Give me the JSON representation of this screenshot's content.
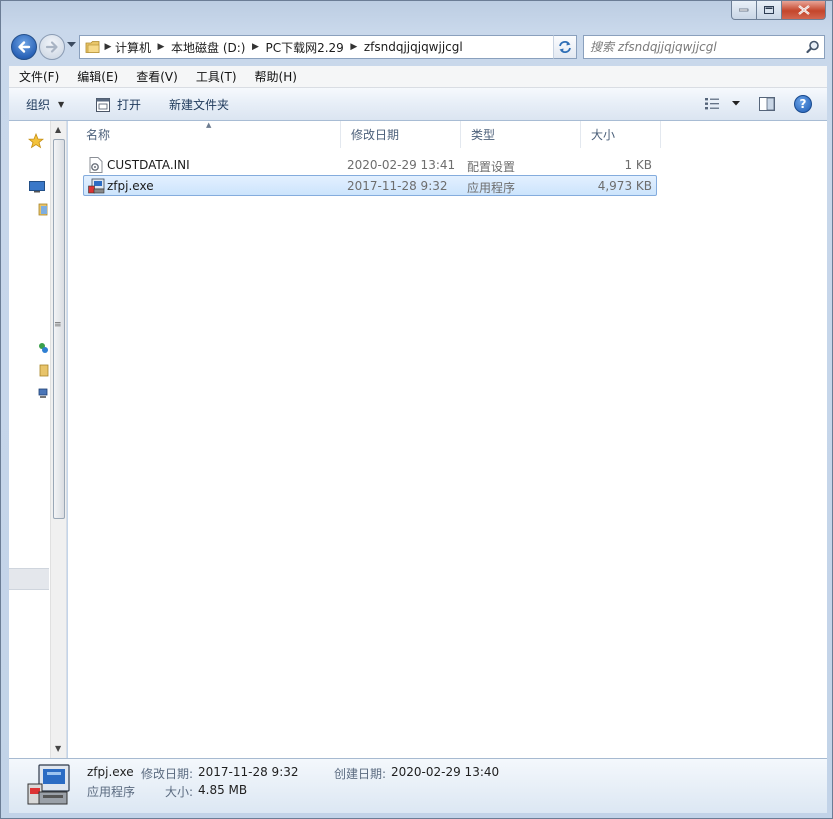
{
  "window": {
    "caption_buttons": [
      "minimize",
      "maximize",
      "close"
    ]
  },
  "address": {
    "breadcrumbs": [
      "计算机",
      "本地磁盘 (D:)",
      "PC下载网2.29",
      "zfsndqjjqjqwjjcgl"
    ]
  },
  "search": {
    "placeholder": "搜索 zfsndqjjqjqwjjcgl"
  },
  "menu": {
    "items": [
      "文件(F)",
      "编辑(E)",
      "查看(V)",
      "工具(T)",
      "帮助(H)"
    ]
  },
  "toolbar": {
    "organize_label": "组织",
    "open_label": "打开",
    "new_folder_label": "新建文件夹"
  },
  "columns": {
    "name": "名称",
    "date": "修改日期",
    "type": "类型",
    "size": "大小"
  },
  "files": [
    {
      "name": "CUSTDATA.INI",
      "date": "2020-02-29 13:41",
      "type": "配置设置",
      "size": "1 KB",
      "icon": "ini-settings-file-icon",
      "selected": false
    },
    {
      "name": "zfpj.exe",
      "date": "2017-11-28 9:32",
      "type": "应用程序",
      "size": "4,973 KB",
      "icon": "setup-installer-icon",
      "selected": true
    }
  ],
  "details": {
    "filename": "zfpj.exe",
    "type": "应用程序",
    "modified_label": "修改日期:",
    "modified_value": "2017-11-28 9:32",
    "created_label": "创建日期:",
    "created_value": "2020-02-29 13:40",
    "size_label": "大小:",
    "size_value": "4.85 MB"
  },
  "colors": {
    "selection_fill": "#cce4fc",
    "selection_border": "#84acdd",
    "chrome": "#c4d3e6"
  }
}
